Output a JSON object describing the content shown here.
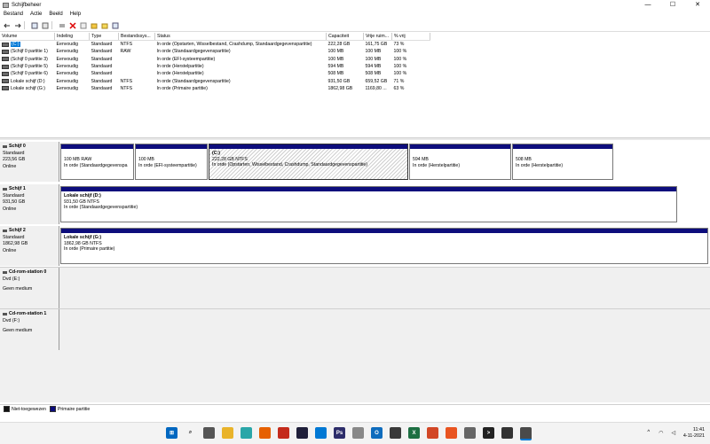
{
  "window": {
    "title": "Schijfbeheer",
    "minimize": "—",
    "maximize": "☐",
    "close": "✕"
  },
  "menu": [
    "Bestand",
    "Actie",
    "Beeld",
    "Help"
  ],
  "table": {
    "headers": [
      "Volume",
      "Indeling",
      "Type",
      "Bestandssys...",
      "Status",
      "Capaciteit",
      "Vrije ruim...",
      "% vrij"
    ],
    "rows": [
      [
        "(C:)",
        "Eenvoudig",
        "Standaard",
        "NTFS",
        "In orde (Opstarten, Wisselbestand, Crashdump, Standaardgegevenspartitie)",
        "222,28 GB",
        "161,75 GB",
        "73 %"
      ],
      [
        "(Schijf 0 partitie 1)",
        "Eenvoudig",
        "Standaard",
        "RAW",
        "In orde (Standaardgegevenspartitie)",
        "100 MB",
        "100 MB",
        "100 %"
      ],
      [
        "(Schijf 0 partitie 3)",
        "Eenvoudig",
        "Standaard",
        "",
        "In orde (EFI-systeempartitie)",
        "100 MB",
        "100 MB",
        "100 %"
      ],
      [
        "(Schijf 0 partitie 5)",
        "Eenvoudig",
        "Standaard",
        "",
        "In orde (Herstelpartitie)",
        "594 MB",
        "594 MB",
        "100 %"
      ],
      [
        "(Schijf 0 partitie 6)",
        "Eenvoudig",
        "Standaard",
        "",
        "In orde (Herstelpartitie)",
        "508 MB",
        "508 MB",
        "100 %"
      ],
      [
        "Lokale schijf (D:)",
        "Eenvoudig",
        "Standaard",
        "NTFS",
        "In orde (Standaardgegevenspartitie)",
        "931,50 GB",
        "659,52 GB",
        "71 %"
      ],
      [
        "Lokale schijf (G:)",
        "Eenvoudig",
        "Standaard",
        "NTFS",
        "In orde (Primaire partitie)",
        "1862,98 GB",
        "1169,80 ...",
        "63 %"
      ]
    ]
  },
  "disks": [
    {
      "name": "Schijf 0",
      "type": "Standaard",
      "size": "223,56 GB",
      "status": "Online",
      "partitions": [
        {
          "title": "",
          "line1": "100 MB RAW",
          "line2": "In orde (Standaardgegevenspa"
        },
        {
          "title": "",
          "line1": "100 MB",
          "line2": "In orde (EFI-systeempartitie)"
        },
        {
          "title": "(C:)",
          "line1": "222,28 GB NTFS",
          "line2": "In orde (Opstarten, Wisselbestand, Crashdump, Standaardgegevenspartitie)"
        },
        {
          "title": "",
          "line1": "594 MB",
          "line2": "In orde (Herstelpartitie)"
        },
        {
          "title": "",
          "line1": "508 MB",
          "line2": "In orde (Herstelpartitie)"
        }
      ]
    },
    {
      "name": "Schijf 1",
      "type": "Standaard",
      "size": "931,50 GB",
      "status": "Online",
      "partitions": [
        {
          "title": "Lokale schijf  (D:)",
          "line1": "931,50 GB NTFS",
          "line2": "In orde (Standaardgegevenspartitie)"
        }
      ]
    },
    {
      "name": "Schijf 2",
      "type": "Standaard",
      "size": "1862,98 GB",
      "status": "Online",
      "partitions": [
        {
          "title": "Lokale schijf  (G:)",
          "line1": "1862,98 GB NTFS",
          "line2": "In orde (Primaire partitie)"
        }
      ]
    }
  ],
  "cdroms": [
    {
      "name": "Cd-rom-station 0",
      "drive": "Dvd (E:)",
      "status": "Geen medium"
    },
    {
      "name": "Cd-rom-station 1",
      "drive": "Dvd (F:)",
      "status": "Geen medium"
    }
  ],
  "legend": {
    "unallocated": "Niet-toegewezen",
    "primary": "Primaire partitie"
  },
  "taskbar": {
    "time": "11:41",
    "date": "4-11-2021"
  },
  "colors": {
    "partition_bar": "#0d0d7c",
    "selection": "#0078d7"
  }
}
